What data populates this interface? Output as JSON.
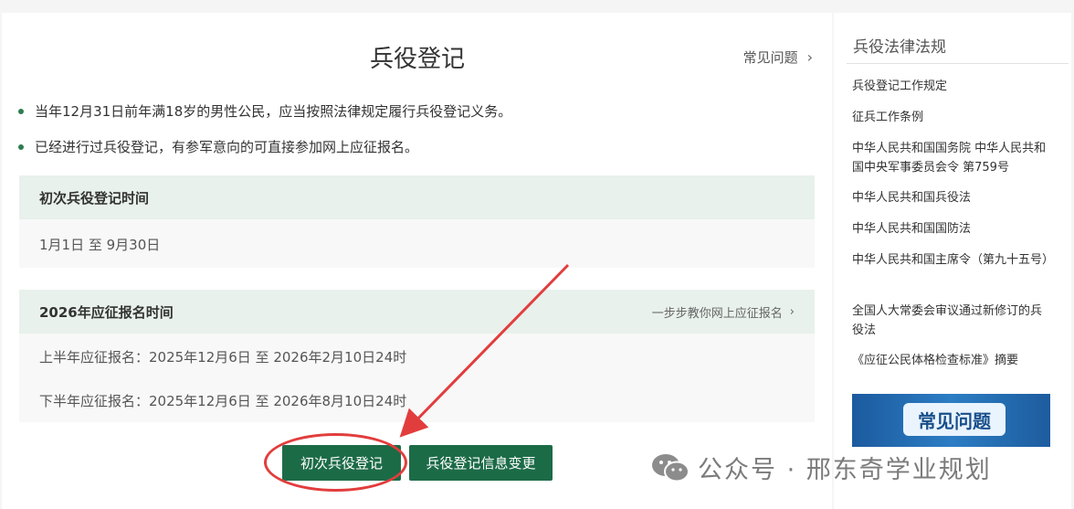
{
  "main": {
    "title": "兵役登记",
    "faq_link": "常见问题",
    "bullets": [
      "当年12月31日前年满18岁的男性公民，应当按照法律规定履行兵役登记义务。",
      "已经进行过兵役登记，有参军意向的可直接参加网上应征报名。"
    ],
    "first_reg_box": {
      "header": "初次兵役登记时间",
      "text": "1月1日 至 9月30日"
    },
    "enlist_box": {
      "header": "2026年应征报名时间",
      "guide_link": "一步步教你网上应征报名",
      "rows": [
        "上半年应征报名：2025年12月6日 至 2026年2月10日24时",
        "下半年应征报名：2025年12月6日 至 2026年8月10日24时"
      ]
    },
    "buttons": {
      "first_registration": "初次兵役登记",
      "info_change": "兵役登记信息变更"
    }
  },
  "sidebar": {
    "title": "兵役法律法规",
    "links": [
      "兵役登记工作规定",
      "征兵工作条例",
      "中华人民共和国国务院 中华人民共和国中央军事委员会令 第759号",
      "中华人民共和国兵役法",
      "中华人民共和国国防法",
      "中华人民共和国主席令（第九十五号）",
      "全国人大常委会审议通过新修订的兵役法",
      "《应征公民体格检查标准》摘要"
    ],
    "banner_label": "常见问题"
  },
  "watermark": "公众号 · 邢东奇学业规划",
  "icons": {
    "chevron": "chevron-right-icon",
    "bullet": "bullet-dot-icon",
    "wechat": "wechat-icon"
  },
  "colors": {
    "accent": "#1c6b47",
    "box_header": "#e8f1ec",
    "annotation": "#e23d3d"
  }
}
